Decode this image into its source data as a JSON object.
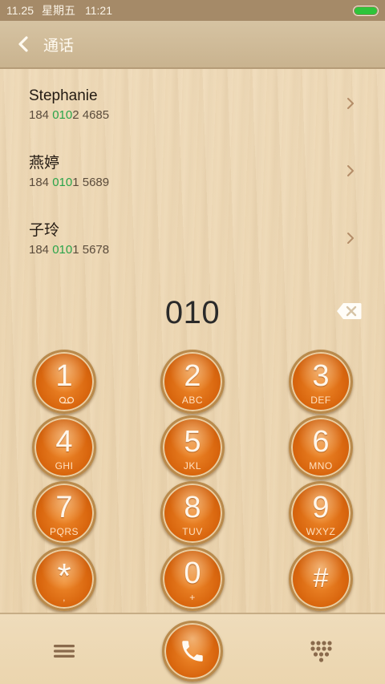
{
  "status_bar": {
    "date": "11.25",
    "weekday": "星期五",
    "time": "11:21",
    "battery_color": "#2ec43a"
  },
  "app_bar": {
    "back_icon": "back-arrow-icon",
    "title": "通话"
  },
  "contacts": [
    {
      "name": "Stephanie",
      "number_prefix": "184 ",
      "number_match": "010",
      "number_suffix": "2 4685"
    },
    {
      "name": "燕婷",
      "number_prefix": "184 ",
      "number_match": "010",
      "number_suffix": "1 5689"
    },
    {
      "name": "子玲",
      "number_prefix": "184 ",
      "number_match": "010",
      "number_suffix": "1 5678"
    }
  ],
  "dial": {
    "number": "010",
    "backspace_icon": "backspace-icon"
  },
  "keypad": [
    {
      "digit": "1",
      "letters": ""
    },
    {
      "digit": "2",
      "letters": "ABC"
    },
    {
      "digit": "3",
      "letters": "DEF"
    },
    {
      "digit": "4",
      "letters": "GHI"
    },
    {
      "digit": "5",
      "letters": "JKL"
    },
    {
      "digit": "6",
      "letters": "MNO"
    },
    {
      "digit": "7",
      "letters": "PQRS"
    },
    {
      "digit": "8",
      "letters": "TUV"
    },
    {
      "digit": "9",
      "letters": "WXYZ"
    },
    {
      "digit": "*",
      "letters": ","
    },
    {
      "digit": "0",
      "letters": "+"
    },
    {
      "digit": "#",
      "letters": ""
    }
  ],
  "bottom_bar": {
    "menu_icon": "menu-icon",
    "call_icon": "phone-icon",
    "dialpad_icon": "dialpad-icon"
  },
  "colors": {
    "key_orange": "#d9660e",
    "match_green": "#2aa44a",
    "header_bg": "#c9b38f"
  }
}
